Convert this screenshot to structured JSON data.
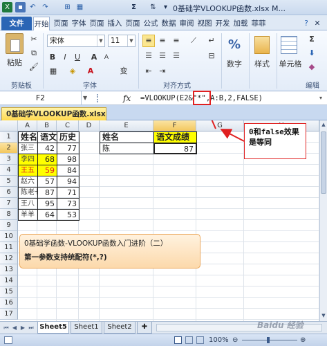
{
  "window": {
    "title": "0基础学VLOOKUP函数.xlsx M...",
    "qa_buttons": [
      "excel-icon",
      "save-icon",
      "undo-icon",
      "redo-icon",
      "insert-icon",
      "format-icon",
      "sigma-icon",
      "sort-icon",
      "dropdown-icon"
    ]
  },
  "ribbon": {
    "file_tab": "文件",
    "tabs": [
      "开始",
      "页面",
      "字体",
      "页面",
      "插入",
      "页面",
      "公式",
      "数据",
      "审阅",
      "视图",
      "开发",
      "加载",
      "菲菲"
    ],
    "clipboard_label": "粘贴",
    "clipboard_group": "剪贴板",
    "font_name": "宋体",
    "font_size": "11",
    "font_group": "字体",
    "bold": "B",
    "italic": "I",
    "underline": "U",
    "align_group": "对齐方式",
    "number_label": "数字",
    "style_label": "样式",
    "cells_label": "单元格",
    "edit_group": "编辑",
    "grow_font": "A",
    "shrink_font": "A",
    "phonetic": "变"
  },
  "formula_bar": {
    "cell_ref": "F2",
    "fx": "fx",
    "formula": "=VLOOKUP(E2&\"*\",A:B,2,FALSE)"
  },
  "workbook_tab": "0基础学VLOOKUP函数.xlsx",
  "columns": [
    "A",
    "B",
    "C",
    "D",
    "E",
    "F",
    "G",
    "H"
  ],
  "rows": [
    "1",
    "2",
    "3",
    "4",
    "5",
    "6",
    "7",
    "8",
    "9",
    "10",
    "11",
    "12",
    "13",
    "14",
    "15",
    "16",
    "17"
  ],
  "table": {
    "headers": [
      "姓名",
      "语文",
      "历史"
    ],
    "rows": [
      [
        "张三",
        "42",
        "77"
      ],
      [
        "李四",
        "68",
        "98"
      ],
      [
        "王五",
        "59",
        "84"
      ],
      [
        "赵六",
        "57",
        "94"
      ],
      [
        "陈老七",
        "87",
        "71"
      ],
      [
        "王八",
        "95",
        "73"
      ],
      [
        "羊羊",
        "64",
        "53"
      ]
    ]
  },
  "lookup": {
    "headers": [
      "姓名",
      "语文成绩"
    ],
    "name": "陈",
    "score": "87"
  },
  "callouts": {
    "note": "0和false效果是等同",
    "main_line1": "0基础学函数-VLOOKUP函数入门进阶（二）",
    "main_line2": "第一参数支持统配符(*,?)"
  },
  "sheets": [
    "Sheet5",
    "Sheet1",
    "Sheet2"
  ],
  "status": {
    "zoom": "100%",
    "watermark": "Baidu 经验"
  },
  "colors": {
    "highlight_yellow": "#ffff00",
    "red_text": "#e02020",
    "file_tab": "#2a65b5"
  }
}
